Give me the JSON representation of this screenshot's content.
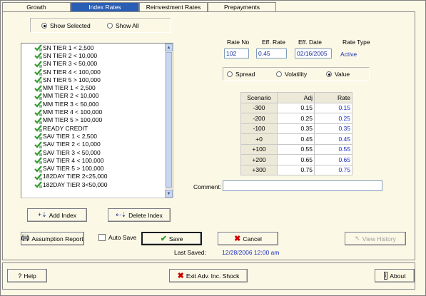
{
  "tabs": [
    "Growth",
    "Index Rates",
    "Reinvestment Rates",
    "Prepayments"
  ],
  "filter": {
    "show_selected": "Show Selected",
    "show_all": "Show All",
    "selected": "show_selected"
  },
  "indexes": [
    "SN TIER 1 < 2,500",
    "SN TIER 2 < 10,000",
    "SN TIER 3 < 50,000",
    "SN TIER 4 < 100,000",
    "SN TIER 5 > 100,000",
    "MM TIER 1 < 2,500",
    "MM TIER 2 < 10,000",
    "MM TIER 3 < 50,000",
    "MM TIER 4 < 100,000",
    "MM TIER 5 > 100,000",
    "READY CREDIT",
    "SAV TIER 1 < 2,500",
    "SAV TIER 2 < 10,000",
    "SAV TIER 3 < 50,000",
    "SAV TIER 4 < 100,000",
    "SAV TIER 5 > 100,000",
    "182DAY TIER 2<25,000",
    "182DAY TIER 3<50,000"
  ],
  "rate": {
    "rate_no_label": "Rate No",
    "eff_rate_label": "Eff. Rate",
    "eff_date_label": "Eff. Date",
    "rate_type_label": "Rate Type",
    "rate_no": "102",
    "eff_rate": "0.45",
    "eff_date": "02/16/2005",
    "rate_type": "Active"
  },
  "mode": {
    "spread": "Spread",
    "volatility": "Volatility",
    "value": "Value",
    "selected": "value"
  },
  "scenario_table": {
    "headers": [
      "Scenario",
      "Adj",
      "Rate"
    ],
    "rows": [
      [
        "-300",
        "0.15",
        "0.15"
      ],
      [
        "-200",
        "0.25",
        "0.25"
      ],
      [
        "-100",
        "0.35",
        "0.35"
      ],
      [
        "+0",
        "0.45",
        "0.45"
      ],
      [
        "+100",
        "0.55",
        "0.55"
      ],
      [
        "+200",
        "0.65",
        "0.65"
      ],
      [
        "+300",
        "0.75",
        "0.75"
      ]
    ]
  },
  "comment": {
    "label": "Comment:",
    "value": ""
  },
  "buttons": {
    "add_index": "Add Index",
    "delete_index": "Delete Index",
    "assumption_report": "Assumption Report",
    "auto_save": "Auto Save",
    "save": "Save",
    "cancel": "Cancel",
    "view_history": "View History",
    "help": "Help",
    "exit": "Exit Adv. Inc. Shock",
    "about": "About"
  },
  "last_saved": {
    "label": "Last Saved:",
    "value": "12/28/2006 12:00 am"
  },
  "colors": {
    "accent": "#2a5eb4",
    "value_text": "#1b2fbf",
    "check_green": "#2e9a2e"
  }
}
